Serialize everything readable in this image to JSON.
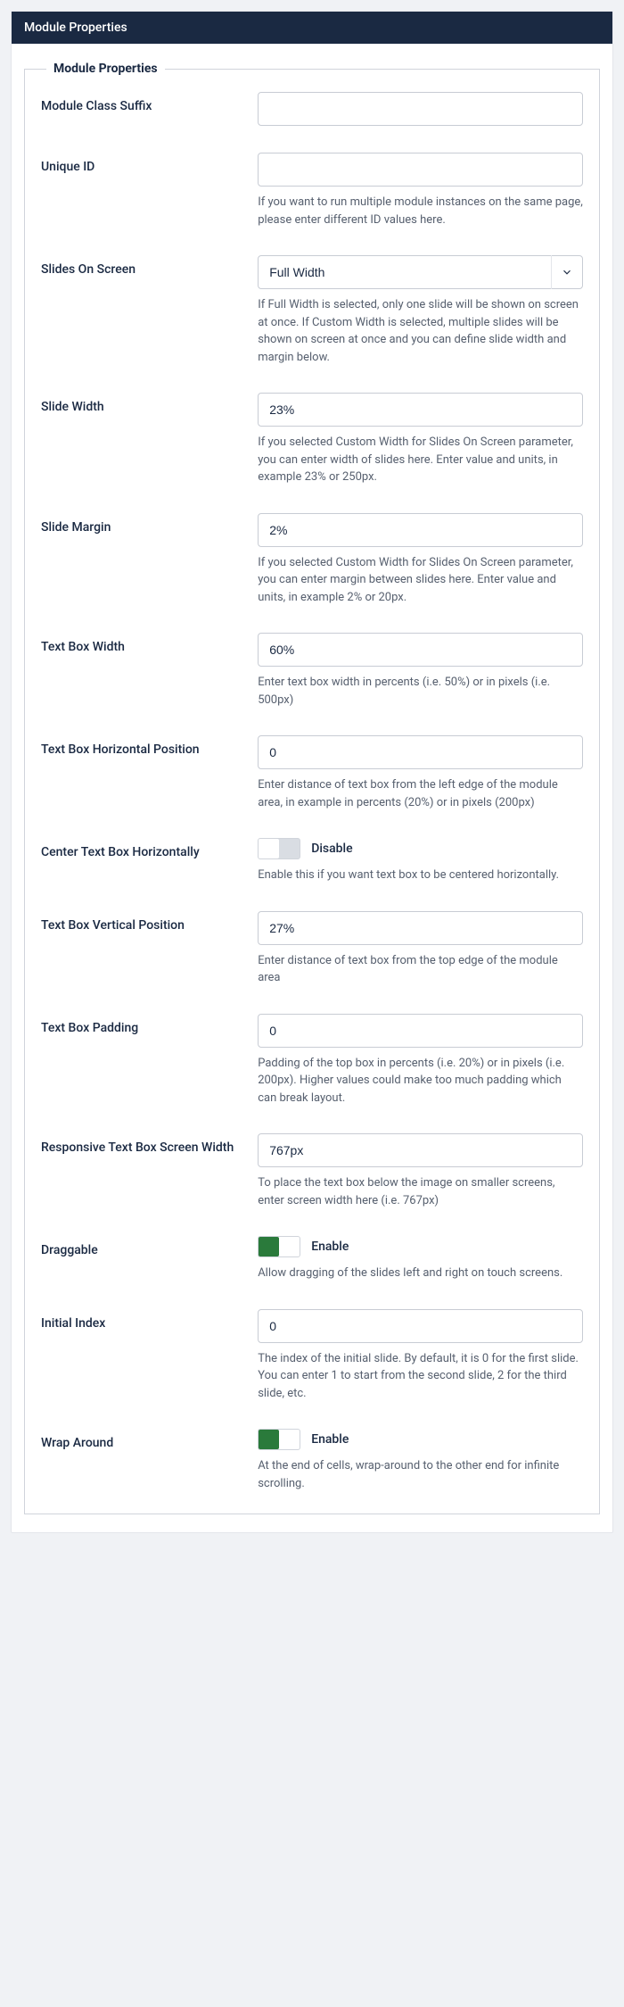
{
  "header": {
    "title": "Module Properties"
  },
  "group": {
    "legend": "Module Properties"
  },
  "fields": {
    "moduleClassSuffix": {
      "label": "Module Class Suffix",
      "value": ""
    },
    "uniqueId": {
      "label": "Unique ID",
      "value": "",
      "help": "If you want to run multiple module instances on the same page, please enter different ID values here."
    },
    "slidesOnScreen": {
      "label": "Slides On Screen",
      "value": "Full Width",
      "help": "If Full Width is selected, only one slide will be shown on screen at once. If Custom Width is selected, multiple slides will be shown on screen at once and you can define slide width and margin below."
    },
    "slideWidth": {
      "label": "Slide Width",
      "value": "23%",
      "help": "If you selected Custom Width for Slides On Screen parameter, you can enter width of slides here. Enter value and units, in example 23% or 250px."
    },
    "slideMargin": {
      "label": "Slide Margin",
      "value": "2%",
      "help": "If you selected Custom Width for Slides On Screen parameter, you can enter margin between slides here. Enter value and units, in example 2% or 20px."
    },
    "textBoxWidth": {
      "label": "Text Box Width",
      "value": "60%",
      "help": "Enter text box width in percents (i.e. 50%) or in pixels (i.e. 500px)"
    },
    "textBoxHorizontal": {
      "label": "Text Box Horizontal Position",
      "value": "0",
      "help": "Enter distance of text box from the left edge of the module area, in example in percents (20%) or in pixels (200px)"
    },
    "centerTextBox": {
      "label": "Center Text Box Horizontally",
      "state": "Disable",
      "help": "Enable this if you want text box to be centered horizontally."
    },
    "textBoxVertical": {
      "label": "Text Box Vertical Position",
      "value": "27%",
      "help": "Enter distance of text box from the top edge of the module area"
    },
    "textBoxPadding": {
      "label": "Text Box Padding",
      "value": "0",
      "help": "Padding of the top box in percents (i.e. 20%) or in pixels (i.e. 200px). Higher values could make too much padding which can break layout."
    },
    "responsiveWidth": {
      "label": "Responsive Text Box Screen Width",
      "value": "767px",
      "help": "To place the text box below the image on smaller screens, enter screen width here (i.e. 767px)"
    },
    "draggable": {
      "label": "Draggable",
      "state": "Enable",
      "help": "Allow dragging of the slides left and right on touch screens."
    },
    "initialIndex": {
      "label": "Initial Index",
      "value": "0",
      "help": "The index of the initial slide. By default, it is 0 for the first slide. You can enter 1 to start from the second slide, 2 for the third slide, etc."
    },
    "wrapAround": {
      "label": "Wrap Around",
      "state": "Enable",
      "help": "At the end of cells, wrap-around to the other end for infinite scrolling."
    }
  }
}
